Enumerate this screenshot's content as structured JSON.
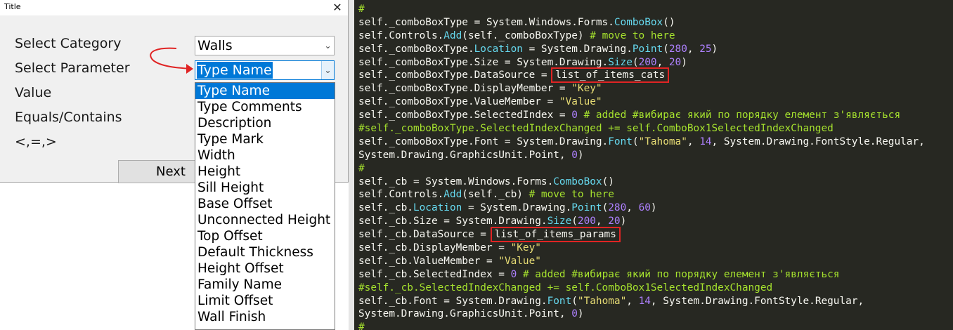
{
  "window": {
    "title": "Title",
    "close_glyph": "✕",
    "labels": [
      "Select Category",
      "Select Parameter",
      "Value",
      "Equals/Contains",
      "<,=,>"
    ],
    "category_combo": {
      "value": "Walls",
      "icon": "chevron-down-icon"
    },
    "parameter_combo": {
      "value": "Type Name",
      "icon": "chevron-down-icon"
    },
    "next_button": "Next",
    "dropdown_options": [
      "Type Name",
      "Type Comments",
      "Description",
      "Type Mark",
      "Width",
      "Height",
      "Sill Height",
      "Base Offset",
      "Unconnected Height",
      "Top Offset",
      "Default Thickness",
      "Height Offset",
      "Family Name",
      "Limit Offset",
      "Wall Finish"
    ],
    "selected_option": "Type Name",
    "accent_color": "#0078d7",
    "arrow_color": "#e02424"
  },
  "editor": {
    "colors": {
      "background": "#272822",
      "text": "#f8f8f2",
      "comment": "#a6e22e",
      "class": "#66d9ef",
      "string": "#e6db74",
      "number": "#ae81ff",
      "highlight_box": "#e02424"
    },
    "lines": [
      [
        {
          "t": "#",
          "c": "cm"
        }
      ],
      [
        {
          "t": "self._comboBoxType = System.Windows.Forms."
        },
        {
          "t": "ComboBox",
          "c": "cls"
        },
        {
          "t": "()"
        }
      ],
      [
        {
          "t": "self.Controls."
        },
        {
          "t": "Add",
          "c": "cls"
        },
        {
          "t": "(self._comboBoxType) "
        },
        {
          "t": "# move to here",
          "c": "cm"
        }
      ],
      [
        {
          "t": "self._comboBoxType."
        },
        {
          "t": "Location",
          "c": "cls"
        },
        {
          "t": " = System.Drawing."
        },
        {
          "t": "Point",
          "c": "cls"
        },
        {
          "t": "("
        },
        {
          "t": "280",
          "c": "num"
        },
        {
          "t": ", "
        },
        {
          "t": "25",
          "c": "num"
        },
        {
          "t": ")"
        }
      ],
      [
        {
          "t": "self._comboBoxType.Size = System.Drawing."
        },
        {
          "t": "Size",
          "c": "cls"
        },
        {
          "t": "("
        },
        {
          "t": "200",
          "c": "num"
        },
        {
          "t": ", "
        },
        {
          "t": "20",
          "c": "num"
        },
        {
          "t": ")"
        }
      ],
      [
        {
          "t": "self._comboBoxType.DataSource = "
        },
        {
          "t": "list_of_items_cats",
          "h": true
        }
      ],
      [
        {
          "t": "self._comboBoxType.DisplayMember = "
        },
        {
          "t": "\"Key\"",
          "c": "str"
        }
      ],
      [
        {
          "t": "self._comboBoxType.ValueMember = "
        },
        {
          "t": "\"Value\"",
          "c": "str"
        }
      ],
      [
        {
          "t": "self._comboBoxType.SelectedIndex = "
        },
        {
          "t": "0",
          "c": "num"
        },
        {
          "t": " "
        },
        {
          "t": "# added #вибирає який по порядку елемент з'являється",
          "c": "cm"
        }
      ],
      [
        {
          "t": "#self._comboBoxType.SelectedIndexChanged += self.ComboBox1SelectedIndexChanged",
          "c": "cm"
        }
      ],
      [
        {
          "t": "self._comboBoxType.Font = System.Drawing."
        },
        {
          "t": "Font",
          "c": "cls"
        },
        {
          "t": "("
        },
        {
          "t": "\"Tahoma\"",
          "c": "str"
        },
        {
          "t": ", "
        },
        {
          "t": "14",
          "c": "num"
        },
        {
          "t": ", System.Drawing.FontStyle.Regular,"
        }
      ],
      [
        {
          "t": "System.Drawing.GraphicsUnit.Point, "
        },
        {
          "t": "0",
          "c": "num"
        },
        {
          "t": ")"
        }
      ],
      [
        {
          "t": "#",
          "c": "cm"
        }
      ],
      [
        {
          "t": "self._cb = System.Windows.Forms."
        },
        {
          "t": "ComboBox",
          "c": "cls"
        },
        {
          "t": "()"
        }
      ],
      [
        {
          "t": "self.Controls."
        },
        {
          "t": "Add",
          "c": "cls"
        },
        {
          "t": "(self._cb) "
        },
        {
          "t": "# move to here",
          "c": "cm"
        }
      ],
      [
        {
          "t": "self._cb."
        },
        {
          "t": "Location",
          "c": "cls"
        },
        {
          "t": " = System.Drawing."
        },
        {
          "t": "Point",
          "c": "cls"
        },
        {
          "t": "("
        },
        {
          "t": "280",
          "c": "num"
        },
        {
          "t": ", "
        },
        {
          "t": "60",
          "c": "num"
        },
        {
          "t": ")"
        }
      ],
      [
        {
          "t": "self._cb.Size = System.Drawing."
        },
        {
          "t": "Size",
          "c": "cls"
        },
        {
          "t": "("
        },
        {
          "t": "200",
          "c": "num"
        },
        {
          "t": ", "
        },
        {
          "t": "20",
          "c": "num"
        },
        {
          "t": ")"
        }
      ],
      [
        {
          "t": "self._cb.DataSource = "
        },
        {
          "t": "list_of_items_params",
          "h": true
        }
      ],
      [
        {
          "t": "self._cb.DisplayMember = "
        },
        {
          "t": "\"Key\"",
          "c": "str"
        }
      ],
      [
        {
          "t": "self._cb.ValueMember = "
        },
        {
          "t": "\"Value\"",
          "c": "str"
        }
      ],
      [
        {
          "t": "self._cb.SelectedIndex = "
        },
        {
          "t": "0",
          "c": "num"
        },
        {
          "t": " "
        },
        {
          "t": "# added #вибирає який по порядку елемент з'являється",
          "c": "cm"
        }
      ],
      [
        {
          "t": "#self._cb.SelectedIndexChanged += self.ComboBox1SelectedIndexChanged",
          "c": "cm"
        }
      ],
      [
        {
          "t": "self._cb.Font = System.Drawing."
        },
        {
          "t": "Font",
          "c": "cls"
        },
        {
          "t": "("
        },
        {
          "t": "\"Tahoma\"",
          "c": "str"
        },
        {
          "t": ", "
        },
        {
          "t": "14",
          "c": "num"
        },
        {
          "t": ", System.Drawing.FontStyle.Regular,"
        }
      ],
      [
        {
          "t": "System.Drawing.GraphicsUnit.Point, "
        },
        {
          "t": "0",
          "c": "num"
        },
        {
          "t": ")"
        }
      ],
      [
        {
          "t": "#",
          "c": "cm"
        }
      ]
    ]
  }
}
